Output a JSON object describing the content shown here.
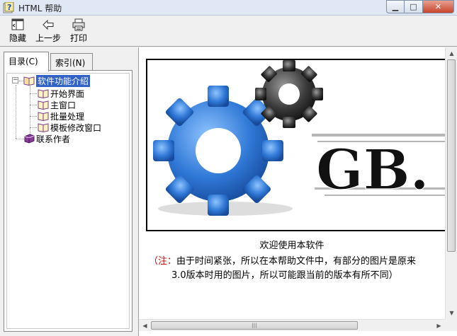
{
  "window": {
    "title": "HTML 帮助",
    "icon": "help-question-icon",
    "controls": {
      "minimize": "▁",
      "maximize": "□",
      "close": "✕"
    }
  },
  "toolbar": {
    "buttons": [
      {
        "label": "隐藏",
        "icon": "hide-pane-icon"
      },
      {
        "label": "上一步",
        "icon": "back-arrow-icon"
      },
      {
        "label": "打印",
        "icon": "print-icon"
      }
    ]
  },
  "sidebar": {
    "tabs": [
      {
        "label": "目录(C)",
        "active": true
      },
      {
        "label": "索引(N)",
        "active": false
      }
    ],
    "tree": {
      "root": {
        "label": "软件功能介绍",
        "expanded": true,
        "selected": true
      },
      "children": [
        {
          "label": "开始界面"
        },
        {
          "label": "主窗口"
        },
        {
          "label": "批量处理"
        },
        {
          "label": "模板修改窗口"
        }
      ],
      "sibling": {
        "label": "联系作者"
      }
    }
  },
  "content": {
    "banner_text": "GB.",
    "welcome": "欢迎使用本软件",
    "note_prefix": "（注：",
    "note_line1_rest": "由于时间紧张，所以在本帮助文件中，有部分的图片是原来",
    "note_line2": "3.0版本时用的图片，所以可能跟当前的版本有所不同）"
  },
  "colors": {
    "selection": "#3162c8",
    "note_red": "#cc0000",
    "gear_blue": "#2f78d6",
    "gear_dark": "#2b2b2b"
  }
}
